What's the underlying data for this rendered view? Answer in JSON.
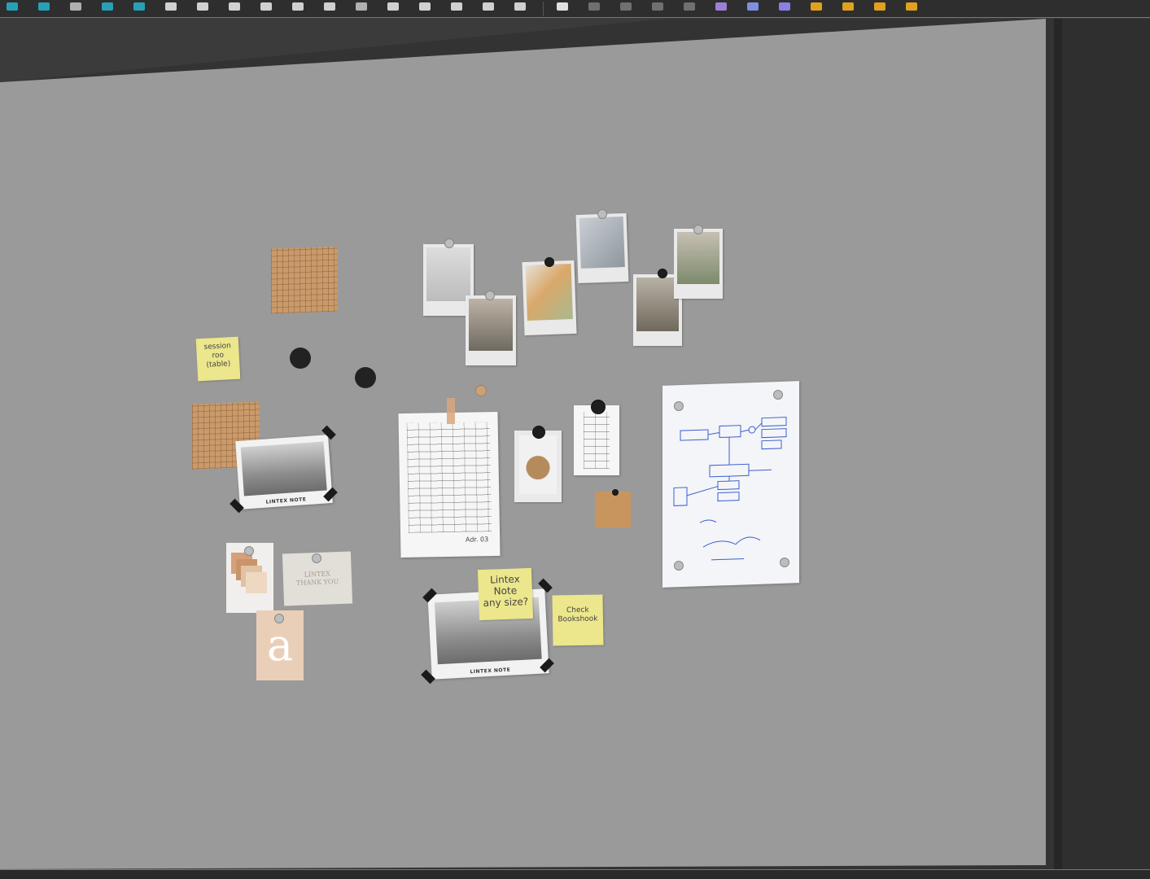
{
  "toolbar": {
    "buttons": [
      {
        "name": "select-icon",
        "color": "#28a0b8"
      },
      {
        "name": "move-icon",
        "color": "#28a0b8"
      },
      {
        "name": "pin-tool-icon",
        "color": "#b0b0b0"
      },
      {
        "name": "snap-icon",
        "color": "#28a0b8"
      },
      {
        "name": "snap-angle-icon",
        "color": "#28a0b8"
      },
      {
        "name": "mirror-icon",
        "color": "#d0d0d0"
      },
      {
        "name": "box-icon",
        "color": "#d0d0d0"
      },
      {
        "name": "layer-icon",
        "color": "#d0d0d0"
      },
      {
        "name": "rotate-icon",
        "color": "#d0d0d0"
      },
      {
        "name": "material-editor-icon",
        "color": "#d0d0d0"
      },
      {
        "name": "undo-icon",
        "color": "#d0d0d0"
      },
      {
        "name": "pin2-icon",
        "color": "#b0b0b0"
      },
      {
        "name": "render-setup-icon",
        "color": "#d0d0d0"
      },
      {
        "name": "render-frame-icon",
        "color": "#d0d0d0"
      },
      {
        "name": "render-window-icon",
        "color": "#d0d0d0"
      },
      {
        "name": "render-icon",
        "color": "#d0d0d0"
      },
      {
        "name": "help-icon",
        "color": "#d0d0d0"
      }
    ],
    "buttons_right": [
      {
        "name": "teapot-render-icon",
        "color": "#e0e0e0"
      },
      {
        "name": "cloud-icon",
        "color": "#707070"
      },
      {
        "name": "display-icon",
        "color": "#707070"
      },
      {
        "name": "camera-icon",
        "color": "#707070"
      },
      {
        "name": "settings-icon",
        "color": "#707070"
      },
      {
        "name": "scene-explorer-icon",
        "color": "#9c7fd8"
      },
      {
        "name": "layer-explorer-icon",
        "color": "#7f8fe0"
      },
      {
        "name": "container-icon",
        "color": "#8a80e0"
      },
      {
        "name": "light-icon",
        "color": "#e0a020"
      },
      {
        "name": "bulb-icon",
        "color": "#e0a020"
      },
      {
        "name": "trophy-icon",
        "color": "#e0a020"
      },
      {
        "name": "chart-icon",
        "color": "#e0a020"
      }
    ]
  },
  "board": {
    "sticky_left": "session\nroo\n(table)",
    "sticky_center": "Lintex\nNote\nany size?",
    "sticky_right": "Check\nBookshook",
    "print_caption_1": "LINTEX NOTE",
    "print_caption_2": "LINTEX NOTE",
    "card_text": "LINTEX\nTHANK YOU",
    "letter": "a",
    "sketch_sig": "Adr. 03"
  },
  "colors": {
    "wall": "#9a9a9a",
    "accent_border": "#8a7a3a",
    "sticky": "#ece68c",
    "cork": "#c99a6b"
  }
}
